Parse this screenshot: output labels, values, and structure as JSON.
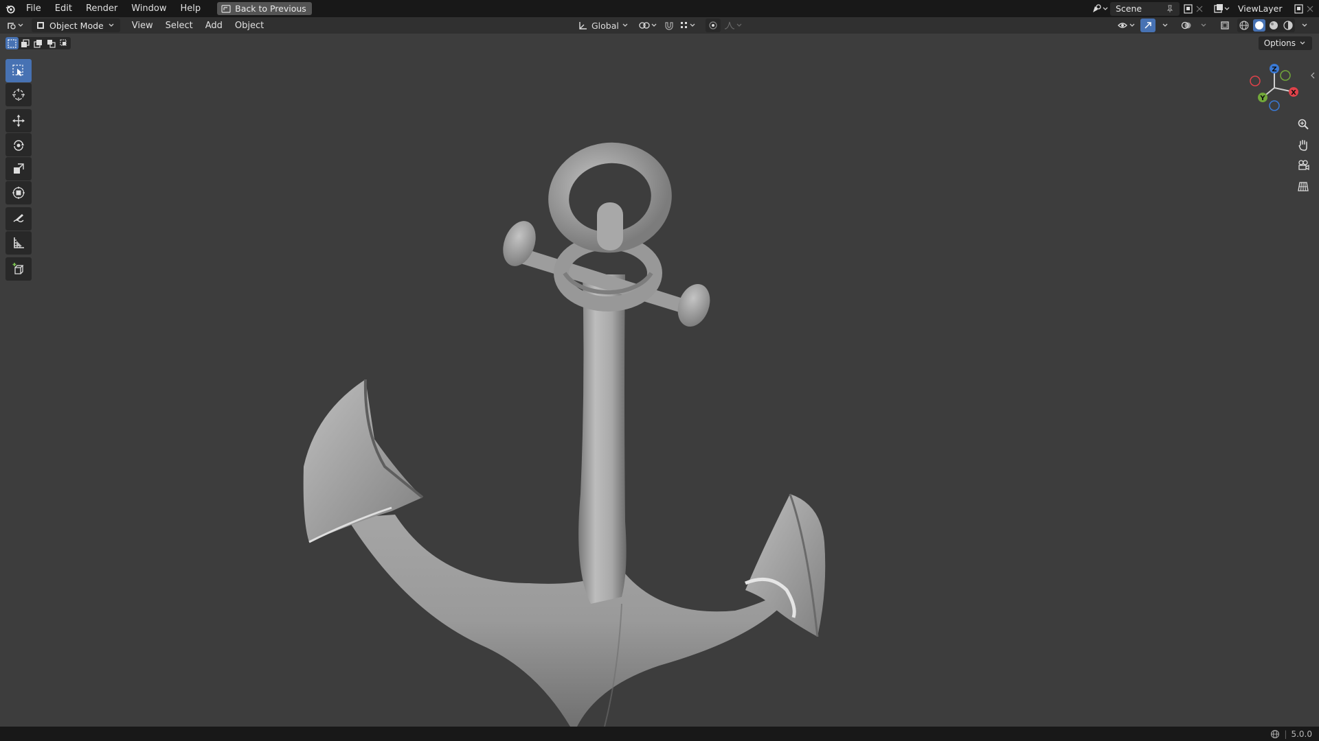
{
  "topbar": {
    "menus": [
      "File",
      "Edit",
      "Render",
      "Window",
      "Help"
    ],
    "back_button": "Back to Previous",
    "scene": "Scene",
    "view_layer": "ViewLayer"
  },
  "header": {
    "mode": "Object Mode",
    "menus": [
      "View",
      "Select",
      "Add",
      "Object"
    ],
    "orientation": "Global"
  },
  "options_label": "Options",
  "toolbar": {
    "tools": [
      "select-box-icon",
      "cursor-icon",
      "move-icon",
      "rotate-icon",
      "scale-icon",
      "transform-icon",
      "annotate-icon",
      "measure-icon",
      "add-cube-icon"
    ],
    "active_tool": "select-box-icon"
  },
  "gizmo": {
    "axes": [
      "Z",
      "X",
      "Y"
    ],
    "colors": {
      "x": "#e0424a",
      "y": "#72a83a",
      "z": "#3a7ad6"
    }
  },
  "navigation_icons": [
    "zoom-icon",
    "pan-hand-icon",
    "camera-icon",
    "ortho-grid-icon"
  ],
  "viewport_object": "anchor-model",
  "status": {
    "version": "5.0.0"
  },
  "colors": {
    "accent": "#4772b3",
    "viewport_bg": "#3d3d3d",
    "topbar_bg": "#181818"
  }
}
